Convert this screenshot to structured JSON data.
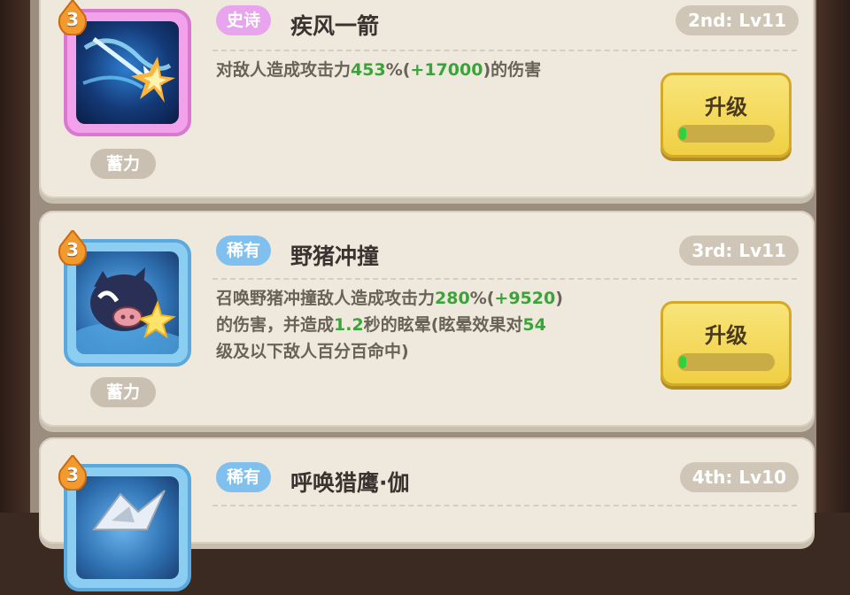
{
  "skills": [
    {
      "level": "3",
      "rarity": "史诗",
      "name": "疾风一箭",
      "rank": "2nd: Lv11",
      "tag": "蓄力",
      "desc_parts": [
        "对敌人造成攻击力",
        "453",
        "%(",
        "+17000",
        ")的伤害"
      ],
      "button": "升级",
      "progress": 0.03
    },
    {
      "level": "3",
      "rarity": "稀有",
      "name": "野猪冲撞",
      "rank": "3rd: Lv11",
      "tag": "蓄力",
      "desc_line1": [
        "召唤野猪冲撞敌人造成攻击力",
        "280",
        "%(",
        "+9520",
        ")"
      ],
      "desc_line2": [
        "的伤害，并造成",
        "1.2",
        "秒的眩晕(眩晕效果对",
        "54"
      ],
      "desc_line3": "级及以下敌人百分百命中)",
      "button": "升级",
      "progress": 0.03
    },
    {
      "level": "3",
      "rarity": "稀有",
      "name": "呼唤猎鹰·伽",
      "rank": "4th: Lv10"
    }
  ],
  "colors": {
    "card_bg": "#efe8dc",
    "highlight_green": "#3aa43a",
    "epic_tag": "#e9a4ee",
    "rare_tag": "#7fc0ee",
    "button_yellow": "#f0cf43"
  },
  "icons": [
    "arrow-wind-skill-icon",
    "boar-charge-skill-icon",
    "falcon-skill-icon",
    "level-flame-badge-icon"
  ]
}
